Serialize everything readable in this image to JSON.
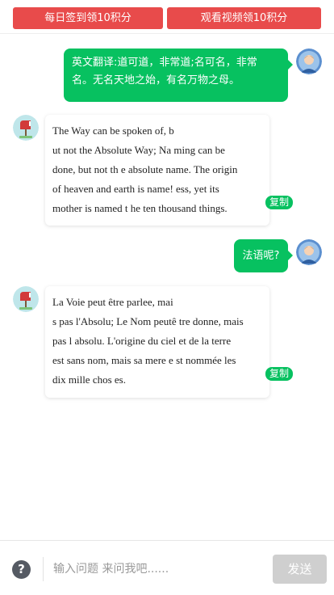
{
  "header": {
    "signin_button": "每日签到领10积分",
    "video_button": "观看视频领10积分"
  },
  "messages": [
    {
      "role": "user",
      "lines": [
        "英文翻译:道可道，非常道;名可名，非常",
        "名。无名天地之始，有名万物之母。"
      ]
    },
    {
      "role": "bot",
      "lines": [
        "The Way can be spoken of, b",
        "ut not the Absolute Way; Na ming can be",
        "done, but not th e absolute name. The origin",
        "of heaven and earth is name! ess, yet its",
        "mother is named t he ten thousand things."
      ],
      "copy_label": "复制"
    },
    {
      "role": "user",
      "lines": [
        "法语呢?"
      ]
    },
    {
      "role": "bot",
      "lines": [
        "La Voie peut être parlee, mai",
        "s pas l'Absolu; Le Nom peutê tre donne, mais",
        "pas l absolu. L'origine du ciel et de la terre",
        "est sans nom, mais sa mere e st nommée les",
        "dix mille chos es."
      ],
      "copy_label": "复制"
    }
  ],
  "input_bar": {
    "help_icon": "?",
    "placeholder": "输入问题 来问我吧......",
    "send_label": "发送"
  },
  "colors": {
    "promo_red": "#e84b4b",
    "bubble_green": "#07c160",
    "send_disabled": "#cfcfcf"
  },
  "icons": {
    "user_avatar": "user-avatar-icon",
    "bot_avatar": "mailbox-avatar-icon",
    "help": "question-circle-icon"
  }
}
